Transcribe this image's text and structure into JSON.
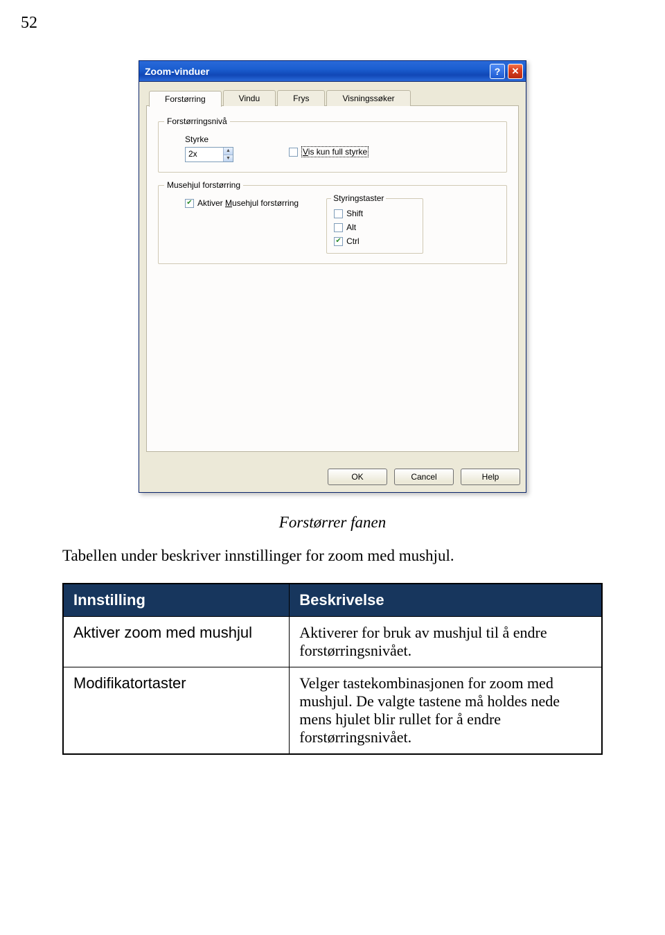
{
  "page_number": "52",
  "window": {
    "title": "Zoom-vinduer",
    "tabs": [
      "Forstørring",
      "Vindu",
      "Frys",
      "Visningssøker"
    ],
    "active_tab_index": 0,
    "group1": {
      "legend": "Forstørringsnivå",
      "strength_label": "Styrke",
      "strength_value": "2x",
      "show_full_label_pre": "V",
      "show_full_label_rest": "is kun full styrke"
    },
    "group2": {
      "legend": "Musehjul forstørring",
      "enable_label_pre": "Aktiver ",
      "enable_label_u": "M",
      "enable_label_rest": "usehjul forstørring",
      "modbox": {
        "legend": "Styringstaster",
        "shift": "Shift",
        "alt": "Alt",
        "ctrl": "Ctrl"
      }
    },
    "buttons": {
      "ok": "OK",
      "cancel": "Cancel",
      "help": "Help"
    }
  },
  "doc": {
    "caption": "Forstørrer fanen",
    "paragraph": "Tabellen under beskriver innstillinger for zoom med mushjul.",
    "table": {
      "headers": [
        "Innstilling",
        "Beskrivelse"
      ],
      "rows": [
        {
          "label": "Aktiver zoom med mushjul",
          "desc": "Aktiverer for bruk av mushjul til å endre forstørringsnivået."
        },
        {
          "label": "Modifikatortaster",
          "desc": "Velger tastekombinasjonen for zoom med mushjul. De valgte tastene må holdes nede mens hjulet blir rullet for å endre forstørringsnivået."
        }
      ]
    }
  }
}
